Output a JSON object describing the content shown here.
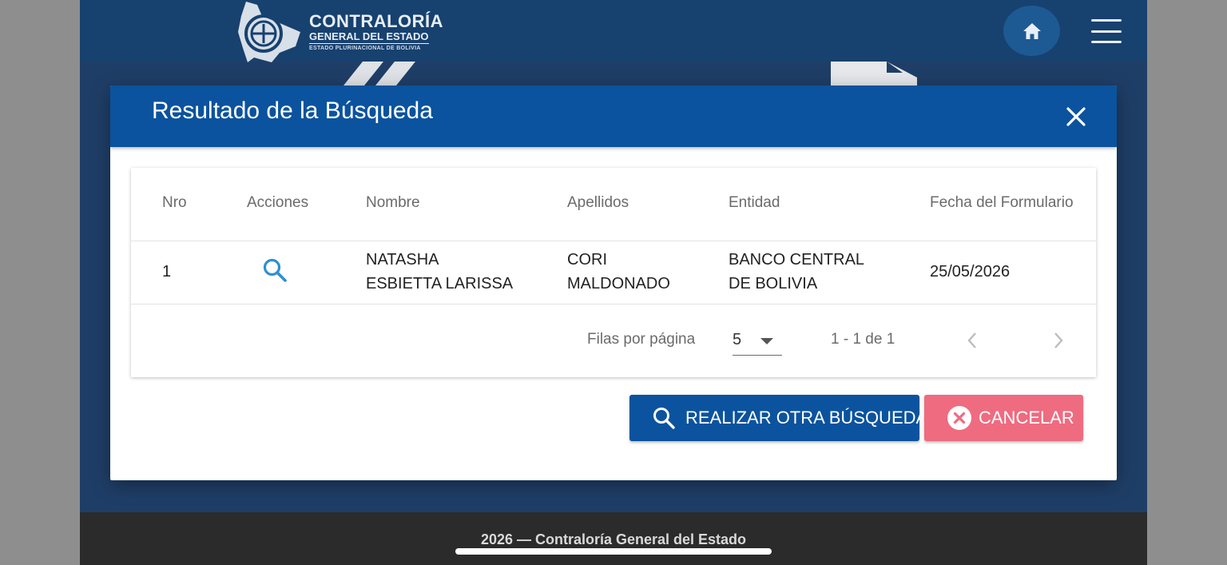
{
  "header": {
    "logo_title": "CONTRALORÍA",
    "logo_subtitle": "GENERAL DEL ESTADO",
    "logo_tagline": "ESTADO PLURINACIONAL DE BOLIVIA",
    "home_icon": "home-icon",
    "menu_icon": "hamburger-menu-icon"
  },
  "modal": {
    "title": "Resultado de la Búsqueda",
    "close_icon": "close-icon",
    "table": {
      "columns": [
        "Nro",
        "Acciones",
        "Nombre",
        "Apellidos",
        "Entidad",
        "Fecha del Formulario"
      ],
      "rows": [
        {
          "nro": "1",
          "action_icon": "search-icon",
          "nombre": [
            "NATASHA",
            "ESBIETTA LARISSA"
          ],
          "apellidos": [
            "CORI",
            "MALDONADO"
          ],
          "entidad": [
            "BANCO CENTRAL",
            "DE BOLIVIA"
          ],
          "fecha": "25/05/2026"
        }
      ]
    },
    "pagination": {
      "rows_per_page_label": "Filas por página",
      "rows_per_page_value": "5",
      "range_text": "1 - 1 de 1",
      "prev_icon": "chevron-left-icon",
      "next_icon": "chevron-right-icon"
    },
    "buttons": {
      "search_again": "REALIZAR OTRA BÚSQUEDA",
      "cancel": "CANCELAR"
    }
  },
  "footer": {
    "text": "2026 — Contraloría General del Estado"
  },
  "colors": {
    "header_bg": "#17416f",
    "modal_header": "#0b539e",
    "primary_button": "#0b539e",
    "cancel_button": "#ef6b80",
    "accent_icon": "#2f8fd0"
  }
}
